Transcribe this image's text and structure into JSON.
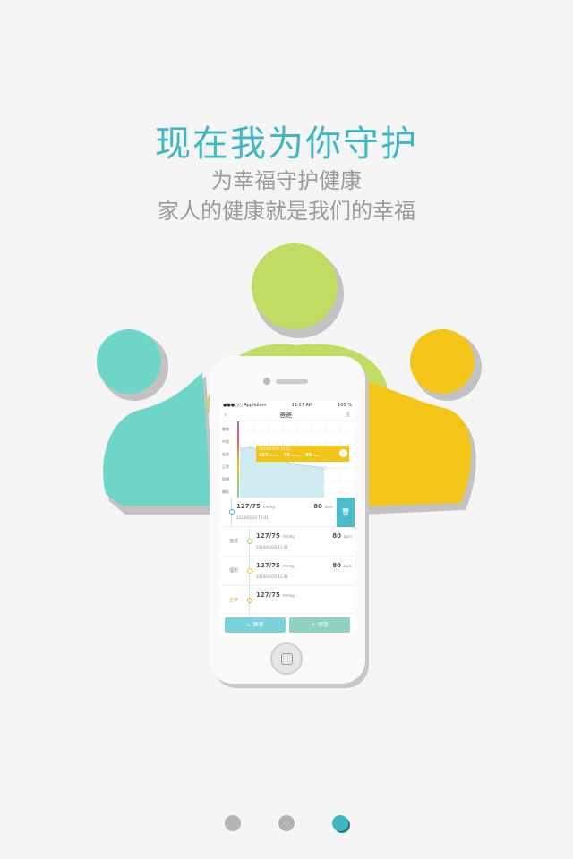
{
  "headline": {
    "title": "现在我为你守护",
    "line1": "为幸福守护健康",
    "line2": "家人的健康就是我们的幸福"
  },
  "colors": {
    "accent": "#3fb6c4",
    "green": "#c0dc62",
    "teal": "#6dd6c8",
    "yellow": "#f3c519"
  },
  "phone_screen": {
    "status": {
      "carrier": "●●●○○ Applidium",
      "time": "11:27 AM",
      "battery": "100 %"
    },
    "nav": {
      "back_icon": "chevron-left-icon",
      "title": "爸爸",
      "share_icon": "share-icon"
    },
    "levels": [
      "重度",
      "中度",
      "轻度",
      "正常",
      "理想",
      "偏低"
    ],
    "tooltip": {
      "datetime": "2014/03/20 13:21",
      "bp": "127",
      "bp_unit": "mmhg",
      "low": "75",
      "low_unit": "mmhg",
      "hr": "80",
      "hr_unit": "bpm"
    },
    "records": [
      {
        "level": "",
        "bp": "127/75",
        "unit": "mmhg",
        "hr": "80",
        "hr_unit": "bpm",
        "date": "2014/03/20 11:41"
      },
      {
        "level": "偏低",
        "bp": "127/75",
        "unit": "mmhg",
        "hr": "80",
        "hr_unit": "bpm",
        "date": "2014/03/20 11:41"
      },
      {
        "level": "理想",
        "bp": "127/75",
        "unit": "mmhg",
        "hr": "80",
        "hr_unit": "bpm",
        "date": "2014/03/20 11:41"
      },
      {
        "level": "正常",
        "bp": "127/75",
        "unit": "mmhg",
        "hr": "",
        "hr_unit": "",
        "date": ""
      }
    ],
    "tabs": {
      "chart": "⊾ 图表",
      "add": "+ 添加"
    }
  },
  "pager": {
    "count": 3,
    "active": 3
  }
}
